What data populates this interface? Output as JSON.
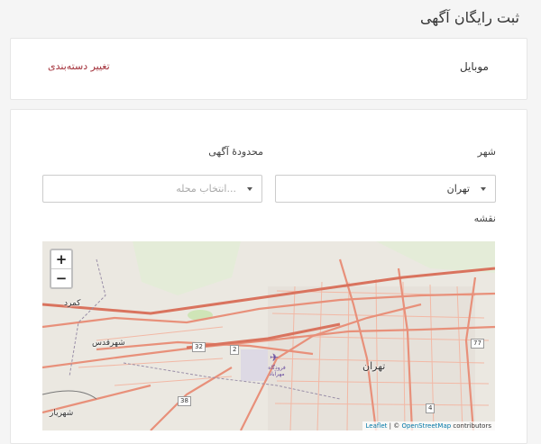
{
  "page": {
    "title": "ثبت رایگان آگهی"
  },
  "category": {
    "name": "موبایل",
    "change_label": "تغییر دسته‌بندی"
  },
  "form": {
    "city_label": "شهر",
    "city_value": "تهران",
    "area_label": "محدودهٔ آگهی",
    "area_placeholder": "انتخاب محله...",
    "map_label": "نقشه"
  },
  "map": {
    "zoom_in": "+",
    "zoom_out": "−",
    "attribution": {
      "leaflet": "Leaflet",
      "separator": "| ©",
      "osm": "OpenStreetMap",
      "contributors": "contributors"
    },
    "places": {
      "tehran": "تهران",
      "shahr_qods": "شهرقدس",
      "shahriar": "شهریار",
      "kamard": "کمرد",
      "airport": "فرودگاه مهرآباد"
    },
    "roads": {
      "r32": "32",
      "r2": "2",
      "r38": "38",
      "r77": "77",
      "r4": "4"
    }
  },
  "colors": {
    "accent": "#a3313a",
    "road_main": "#e8907a",
    "road_minor": "#f2b8a5",
    "green": "#cfe5b7"
  },
  "icons": {
    "airport": "airplane-icon",
    "caret": "caret-down-icon"
  }
}
